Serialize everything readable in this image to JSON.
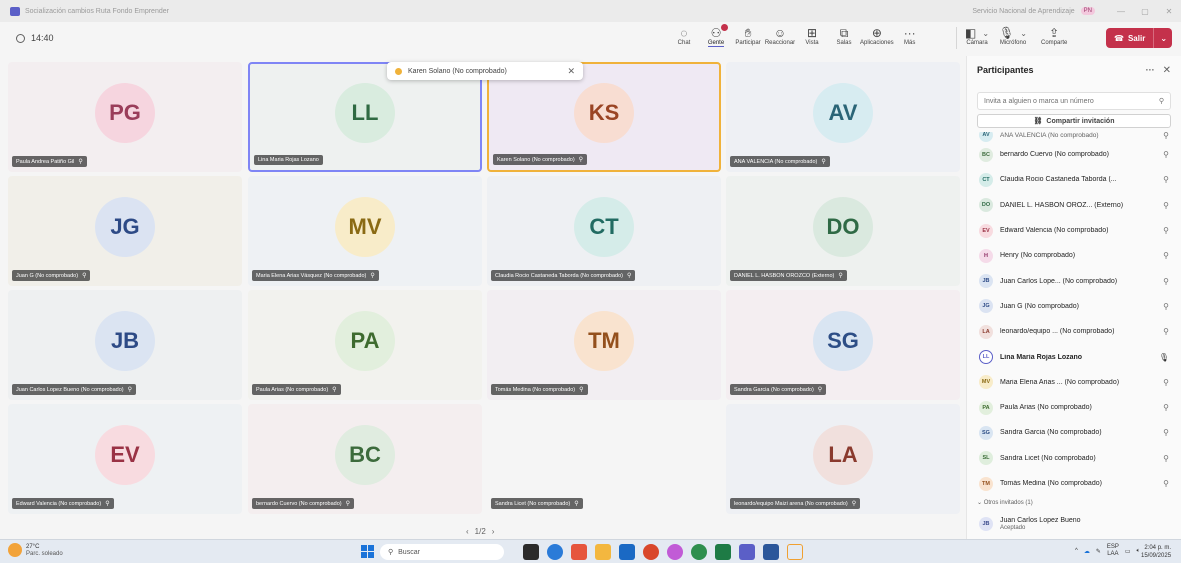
{
  "window": {
    "title": "Socialización cambios Ruta Fondo Emprender",
    "org": "Servicio Nacional de Aprendizaje",
    "org_badge": "PN"
  },
  "meeting": {
    "elapsed": "14:40"
  },
  "toolbar": {
    "items": [
      {
        "label": "Chat",
        "icon": "chat-icon"
      },
      {
        "label": "Gente",
        "icon": "people-icon"
      },
      {
        "label": "Participar",
        "icon": "raise-hand-icon"
      },
      {
        "label": "Reaccionar",
        "icon": "smile-icon"
      },
      {
        "label": "Vista",
        "icon": "grid-icon"
      },
      {
        "label": "Salas",
        "icon": "rooms-icon"
      },
      {
        "label": "Aplicaciones",
        "icon": "add-app-icon"
      },
      {
        "label": "Más",
        "icon": "more-icon"
      }
    ],
    "camera": "Cámara",
    "mic": "Micrófono",
    "share": "Comparte",
    "leave": "Salir"
  },
  "toast": {
    "name": "Karen Solano (No comprobado)"
  },
  "tiles": [
    {
      "initials": "PG",
      "name": "Paula Andrea Patiño Gil",
      "bg": "#f3eef0",
      "avbg": "#f6d5df",
      "avfg": "#9a3d5a"
    },
    {
      "initials": "LL",
      "name": "Lina Maria Rojas Lozano",
      "bg": "#eef1f0",
      "avbg": "#d9ecdf",
      "avfg": "#2f6a42",
      "speaking": true
    },
    {
      "initials": "KS",
      "name": "Karen Solano (No comprobado)",
      "bg": "#efe9f3",
      "avbg": "#f8ddd2",
      "avfg": "#9a4424",
      "pinned": true
    },
    {
      "initials": "AV",
      "name": "ANA VALENCIA (No comprobado)",
      "bg": "#eef0f4",
      "avbg": "#d7ecf1",
      "avfg": "#2b6577"
    },
    {
      "initials": "JG",
      "name": "Juan G (No comprobado)",
      "bg": "#f1efe9",
      "avbg": "#dbe3f2",
      "avfg": "#2d4a86"
    },
    {
      "initials": "MV",
      "name": "Maria Elena Arias Vásquez (No comprobado)",
      "bg": "#eef1f4",
      "avbg": "#f8ecc9",
      "avfg": "#8a6a14"
    },
    {
      "initials": "CT",
      "name": "Claudia Rocio Castaneda Taborda (No comprobado)",
      "bg": "#eef0f3",
      "avbg": "#d5ece9",
      "avfg": "#216b62"
    },
    {
      "initials": "DO",
      "name": "DANIEL L. HASBON OROZCO (Externo)",
      "bg": "#eef1ef",
      "avbg": "#dae9df",
      "avfg": "#2f6a45"
    },
    {
      "initials": "JB",
      "name": "Juan Carlos Lopez Bueno (No comprobado)",
      "bg": "#eef0f1",
      "avbg": "#dbe4f2",
      "avfg": "#2d4a86"
    },
    {
      "initials": "PA",
      "name": "Paula Arias (No comprobado)",
      "bg": "#f2f2ee",
      "avbg": "#e2efdd",
      "avfg": "#3e6b2f"
    },
    {
      "initials": "TM",
      "name": "Tomás Medina (No comprobado)",
      "bg": "#f2eef2",
      "avbg": "#f9e3cf",
      "avfg": "#94501d"
    },
    {
      "initials": "SG",
      "name": "Sandra Garcia (No comprobado)",
      "bg": "#f4eef1",
      "avbg": "#d9e5f2",
      "avfg": "#2d4e86"
    },
    {
      "initials": "EV",
      "name": "Edward Valencia (No comprobado)",
      "bg": "#eef1f3",
      "avbg": "#f8dbe0",
      "avfg": "#9a3245"
    },
    {
      "initials": "BC",
      "name": "bernardo Cuervo (No comprobado)",
      "bg": "#f4eeef",
      "avbg": "#e0ece0",
      "avfg": "#3c6b3c"
    },
    {
      "initials": "",
      "name": "Sandra Licet (No comprobado)",
      "bg": "#f5f5f5",
      "avbg": "#f5f5f5",
      "avfg": "#f5f5f5"
    },
    {
      "initials": "LA",
      "name": "leonardo/equipo Maizi arena (No comprobado)",
      "bg": "#eef0f4",
      "avbg": "#f1e0dd",
      "avfg": "#8a3a2e"
    }
  ],
  "pager": {
    "prev": "‹",
    "label": "1/2",
    "next": "›"
  },
  "panel": {
    "title": "Participantes",
    "invite_placeholder": "Invita a alguien o marca un número",
    "share_invite": "Compartir invitación",
    "participants": [
      {
        "initials": "AV",
        "name": "ANA VALENCIA (No comprobado)",
        "avbg": "#d7ecf1",
        "avfg": "#2b6577"
      },
      {
        "initials": "BC",
        "name": "bernardo Cuervo (No comprobado)",
        "avbg": "#e0ece0",
        "avfg": "#3c6b3c"
      },
      {
        "initials": "CT",
        "name": "Claudia Rocio Castaneda Taborda (...",
        "avbg": "#d5ece9",
        "avfg": "#216b62"
      },
      {
        "initials": "DO",
        "name": "DANIEL L. HASBON OROZ... (Externo)",
        "avbg": "#dae9df",
        "avfg": "#2f6a45"
      },
      {
        "initials": "EV",
        "name": "Edward Valencia (No comprobado)",
        "avbg": "#f8dbe0",
        "avfg": "#9a3245"
      },
      {
        "initials": "H",
        "name": "Henry (No comprobado)",
        "avbg": "#f5dbe9",
        "avfg": "#8e2f64"
      },
      {
        "initials": "JB",
        "name": "Juan Carlos Lope... (No comprobado)",
        "avbg": "#dbe4f2",
        "avfg": "#2d4a86"
      },
      {
        "initials": "JG",
        "name": "Juan G (No comprobado)",
        "avbg": "#dbe3f2",
        "avfg": "#2d4a86"
      },
      {
        "initials": "LA",
        "name": "leonardo/equipo ... (No comprobado)",
        "avbg": "#f1e0dd",
        "avfg": "#8a3a2e"
      },
      {
        "initials": "LL",
        "name": "Lina Maria Rojas Lozano",
        "avbg": "#ffffff",
        "avfg": "#5b5fc7",
        "me": true
      },
      {
        "initials": "MV",
        "name": "Maria Elena Arias ... (No comprobado)",
        "avbg": "#f8ecc9",
        "avfg": "#8a6a14"
      },
      {
        "initials": "PA",
        "name": "Paula Arias (No comprobado)",
        "avbg": "#e2efdd",
        "avfg": "#3e6b2f"
      },
      {
        "initials": "SG",
        "name": "Sandra Garcia (No comprobado)",
        "avbg": "#d9e5f2",
        "avfg": "#2d4e86"
      },
      {
        "initials": "SL",
        "name": "Sandra Licet (No comprobado)",
        "avbg": "#dfeedd",
        "avfg": "#3a6b36"
      },
      {
        "initials": "TM",
        "name": "Tomás Medina (No comprobado)",
        "avbg": "#f9e3cf",
        "avfg": "#94501d"
      }
    ],
    "others_label": "Otros invitados (1)",
    "guest": {
      "initials": "JB",
      "name": "Juan Carlos Lopez Bueno",
      "status": "Aceptado"
    }
  },
  "taskbar": {
    "temp": "27°C",
    "weather": "Parc. soleado",
    "search": "Buscar",
    "lang1": "ESP",
    "lang2": "LAA",
    "time": "2:04 p. m.",
    "date": "15/09/2025"
  }
}
